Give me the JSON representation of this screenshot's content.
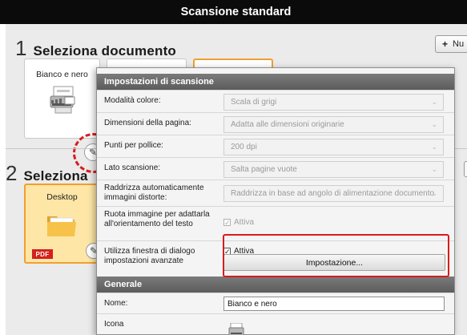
{
  "window": {
    "title": "Scansione standard"
  },
  "step1": {
    "number": "1",
    "title": "Seleziona documento",
    "new_button_label": "Nu",
    "cards": [
      {
        "label": "Bianco e nero"
      }
    ]
  },
  "step2": {
    "number": "2",
    "title": "Seleziona",
    "cards": [
      {
        "label": "Desktop",
        "badge": "PDF"
      }
    ]
  },
  "dialog": {
    "scan_section_title": "Impostazioni di scansione",
    "rows": [
      {
        "label": "Modalità colore:",
        "value": "Scala di grigi"
      },
      {
        "label": "Dimensioni della pagina:",
        "value": "Adatta alle dimensioni originarie"
      },
      {
        "label": "Punti per pollice:",
        "value": "200 dpi"
      },
      {
        "label": "Lato scansione:",
        "value": "Salta pagine vuote"
      },
      {
        "label": "Raddrizza automaticamente immagini distorte:",
        "value": "Raddrizza in base ad angolo di alimentazione documento"
      }
    ],
    "rotate": {
      "label": "Ruota immagine per adattarla all'orientamento del testo",
      "checkbox_label": "Attiva",
      "checked": true
    },
    "advanced": {
      "label": "Utilizza finestra di dialogo impostazioni avanzate",
      "checkbox_label": "Attiva",
      "checked": true,
      "button_label": "Impostazione..."
    },
    "general_section_title": "Generale",
    "name": {
      "label": "Nome:",
      "value": "Bianco e nero"
    },
    "icon": {
      "label": "Icona"
    }
  },
  "colors": {
    "highlight": "#d91c1c",
    "folder": "#f2b63c",
    "selected_border": "#f0a030"
  }
}
